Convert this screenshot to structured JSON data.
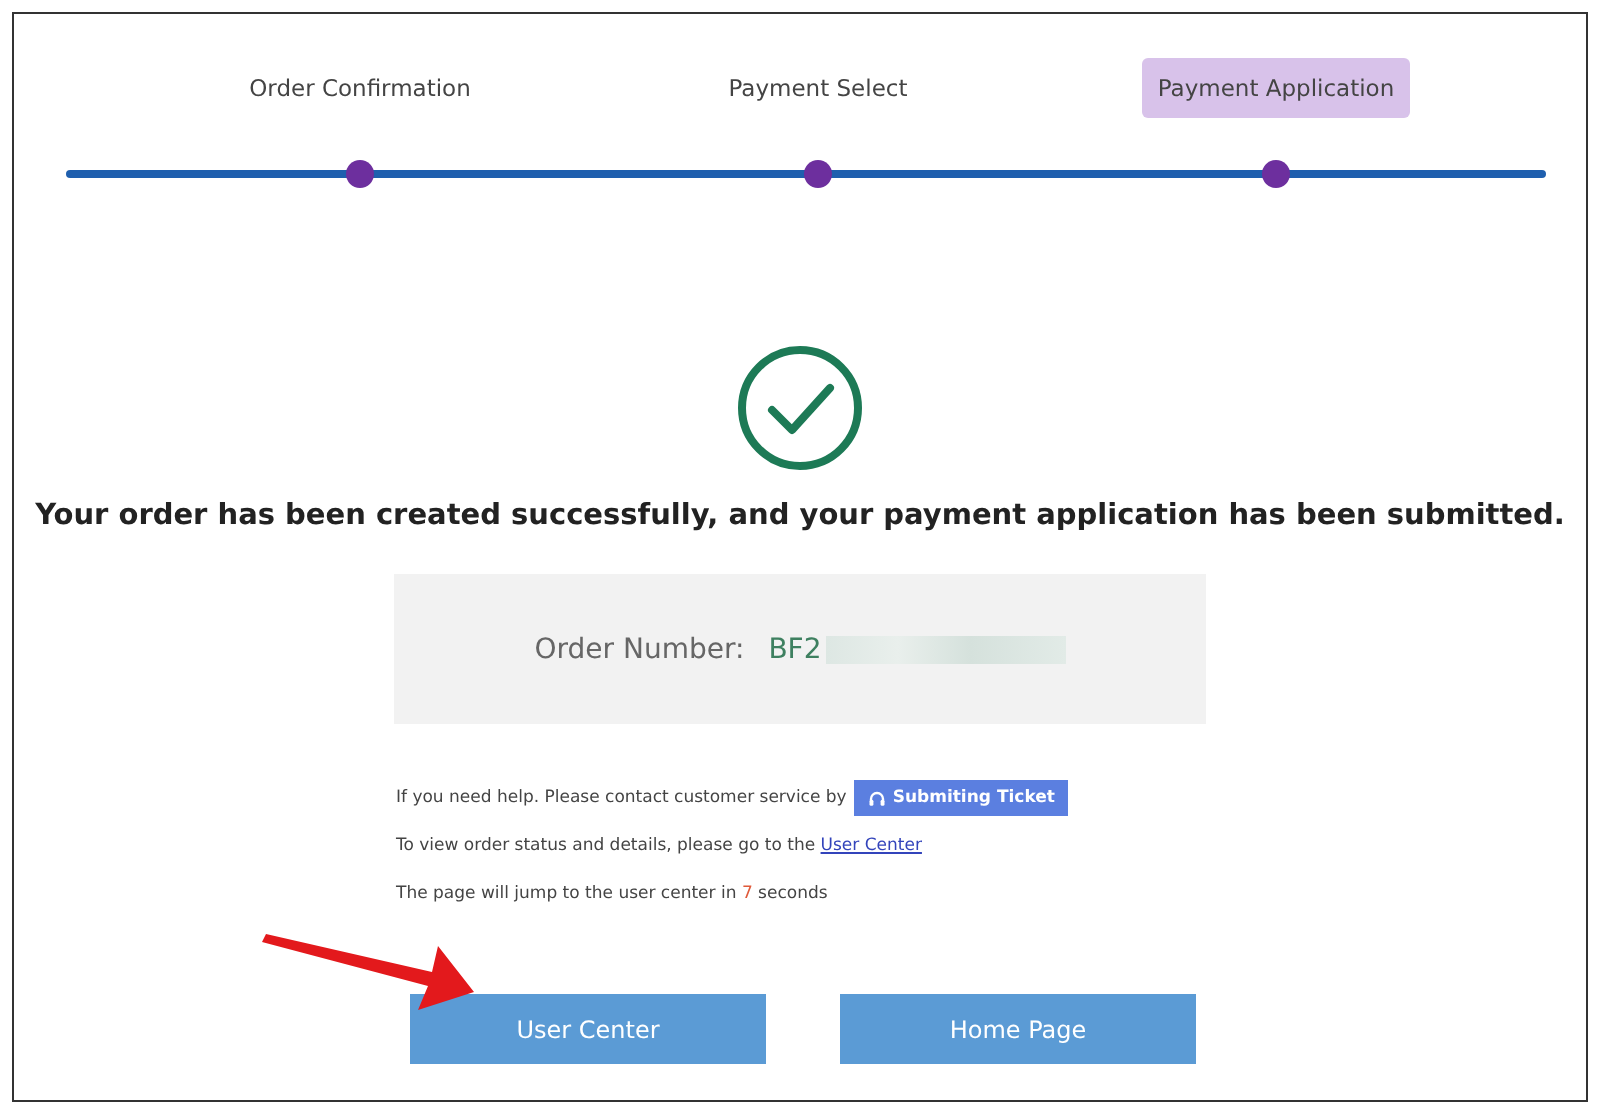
{
  "steps": [
    {
      "label": "Order Confirmation",
      "selected": false
    },
    {
      "label": "Payment Select",
      "selected": false
    },
    {
      "label": "Payment Application",
      "selected": true
    }
  ],
  "message": "Your order has been created successfully, and your payment application has been submitted.",
  "order": {
    "label": "Order Number:",
    "value": "BF2"
  },
  "help": {
    "text": "If you need help. Please contact customer service by",
    "button": "Submiting Ticket"
  },
  "status": {
    "text": "To view order status and details, please go to the",
    "link": "User Center"
  },
  "redirect": {
    "before": "The page will jump to the user center in",
    "count": "7",
    "after": "seconds"
  },
  "buttons": [
    {
      "label": "User Center"
    },
    {
      "label": "Home Page"
    }
  ]
}
